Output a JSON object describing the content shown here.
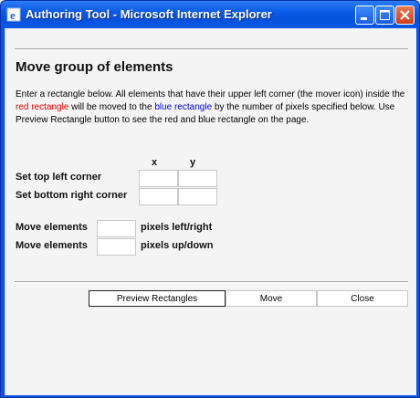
{
  "window": {
    "title": "Authoring Tool - Microsoft Internet Explorer",
    "icon": "ie-icon",
    "controls": {
      "minimize": "minimize-icon",
      "maximize": "maximize-icon",
      "close": "close-icon"
    }
  },
  "dialog": {
    "heading": "Move group of elements",
    "description": {
      "part1": "Enter a rectangle below. All elements that have their upper left corner (the mover icon) inside the ",
      "red_text": "red rectangle",
      "part2": " will be moved to the ",
      "blue_text": "blue rectangle",
      "part3": " by the number of pixels specified below. Use Preview Rectangle button to see the red and blue rectangle on the page."
    },
    "columns": {
      "x": "x",
      "y": "y"
    },
    "rectangle": {
      "top_left_label": "Set top left corner",
      "top_left_x": "",
      "top_left_y": "",
      "bottom_right_label": "Set bottom right corner",
      "bottom_right_x": "",
      "bottom_right_y": ""
    },
    "move": {
      "horizontal_label": "Move elements",
      "horizontal_value": "",
      "horizontal_unit": "pixels left/right",
      "vertical_label": "Move elements",
      "vertical_value": "",
      "vertical_unit": "pixels up/down"
    },
    "buttons": {
      "preview": "Preview Rectangles",
      "move": "Move",
      "close": "Close"
    }
  },
  "colors": {
    "titlebar": "#0a5be8",
    "red_text": "#e00000",
    "blue_text": "#0000d8",
    "background": "#f4f4f4"
  }
}
